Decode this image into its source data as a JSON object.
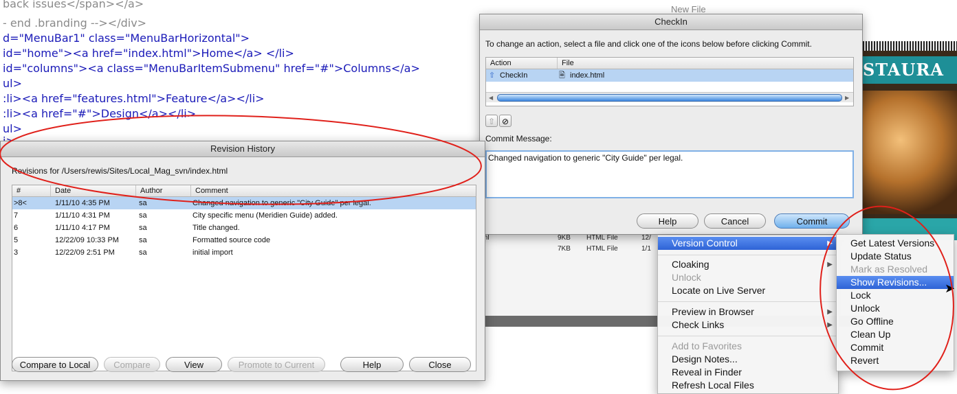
{
  "code": {
    "lines": [
      "back issues</span></a>",
      "- end .branding --></div>",
      "d=\"MenuBar1\" class=\"MenuBarHorizontal\">",
      "id=\"home\"><a href=\"index.html\">Home</a> </li>",
      "id=\"columns\"><a class=\"MenuBarItemSubmenu\" href=\"#\">Columns</a>",
      "ul>",
      ":li><a href=\"features.html\">Feature</a></li>",
      ":li><a href=\"#\">Design</a></li>",
      "ul>",
      "i>"
    ]
  },
  "revision_history": {
    "title": "Revision History",
    "path_label": "Revisions for /Users/rewis/Sites/Local_Mag_svn/index.html",
    "columns": [
      "#",
      "Date",
      "Author",
      "Comment"
    ],
    "rows": [
      {
        "num": ">8<",
        "date": "1/11/10 4:35 PM",
        "author": "sa",
        "comment": "Changed navigation to generic \"City Guide\" per legal."
      },
      {
        "num": "7",
        "date": "1/11/10 4:31 PM",
        "author": "sa",
        "comment": "City specific menu (Meridien Guide) added."
      },
      {
        "num": "6",
        "date": "1/11/10 4:17 PM",
        "author": "sa",
        "comment": "Title changed."
      },
      {
        "num": "5",
        "date": "12/22/09 10:33 PM",
        "author": "sa",
        "comment": "Formatted source code"
      },
      {
        "num": "3",
        "date": "12/22/09 2:51 PM",
        "author": "sa",
        "comment": "initial import"
      }
    ],
    "buttons": {
      "compare_local": "Compare to Local",
      "compare": "Compare",
      "view": "View",
      "promote": "Promote to Current",
      "help": "Help",
      "close": "Close"
    }
  },
  "checkin": {
    "title": "CheckIn",
    "instructions": "To change an action, select a file and click one of the icons below before clicking Commit.",
    "columns": [
      "Action",
      "File"
    ],
    "file_row": {
      "action": "CheckIn",
      "file": "index.html"
    },
    "commit_label": "Commit Message:",
    "commit_message": "Changed navigation to generic \"City Guide\" per legal.",
    "buttons": {
      "help": "Help",
      "cancel": "Cancel",
      "commit": "Commit"
    }
  },
  "file_panel": {
    "rows": [
      {
        "size": "9KB",
        "type": "HTML File",
        "mod": "12/"
      },
      {
        "size": "7KB",
        "type": "HTML File",
        "mod": "1/1"
      }
    ],
    "partial_left": "ml",
    "behind_top": "New File"
  },
  "restaurant": {
    "banner": "STAURA"
  },
  "context_menu": {
    "items": [
      {
        "label": "Version Control",
        "highlight": true,
        "arrow": true
      },
      {
        "label": "Cloaking",
        "arrow": true
      },
      {
        "label": "Unlock",
        "disabled": true
      },
      {
        "label": "Locate on Live Server"
      },
      {
        "label": "Preview in Browser",
        "arrow": true
      },
      {
        "label": "Check Links",
        "arrow": true
      },
      {
        "label": "Add to Favorites",
        "disabled": true
      },
      {
        "label": "Design Notes..."
      },
      {
        "label": "Reveal in Finder"
      },
      {
        "label": "Refresh Local Files"
      }
    ]
  },
  "submenu": {
    "items": [
      {
        "label": "Get Latest Versions"
      },
      {
        "label": "Update Status"
      },
      {
        "label": "Mark as Resolved",
        "disabled": true
      },
      {
        "label": "Show Revisions...",
        "highlight": true
      },
      {
        "label": "Lock"
      },
      {
        "label": "Unlock"
      },
      {
        "label": "Go Offline"
      },
      {
        "label": "Clean Up"
      },
      {
        "label": "Commit"
      },
      {
        "label": "Revert"
      }
    ]
  },
  "colors": {
    "annotation": "#e0201a",
    "selection": "#b8d4f3",
    "menu_highlight": "#2e63d6",
    "code_tag": "#1a1ab8"
  }
}
